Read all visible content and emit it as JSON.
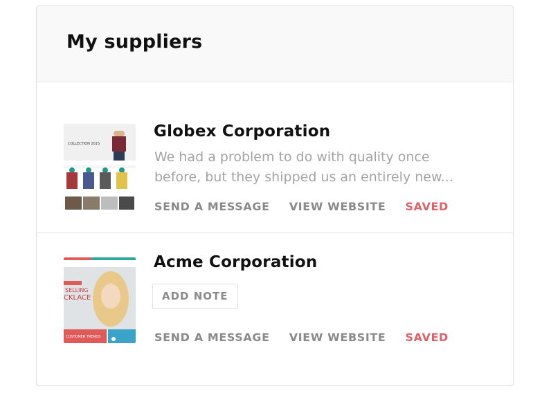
{
  "panel": {
    "title": "My suppliers"
  },
  "suppliers": [
    {
      "name": "Globex Corporation",
      "description": "We had a problem to do with quality once before, but they shipped us an entirely new...",
      "actions": {
        "message": "SEND A MESSAGE",
        "website": "VIEW WEBSITE",
        "saved": "SAVED"
      },
      "thumbnail_text": "COLLECTION 2015"
    },
    {
      "name": "Acme Corporation",
      "note_label": "ADD NOTE",
      "actions": {
        "message": "SEND A MESSAGE",
        "website": "VIEW WEBSITE",
        "saved": "SAVED"
      },
      "thumbnail_text": [
        "SELLING",
        "CKLACE",
        "CUSTOMER TRENDS"
      ]
    }
  ],
  "colors": {
    "saved": "#e2606a",
    "action": "#8a8a8a",
    "description": "#a3a3a3"
  }
}
